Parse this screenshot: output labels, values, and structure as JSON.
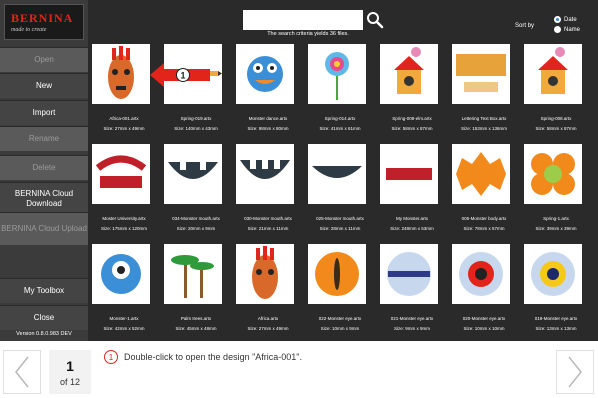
{
  "app": {
    "brand": "BERNINA",
    "tagline": "made to create",
    "version": "Version 0.8.0.983 DEV"
  },
  "sidebar": {
    "buttons": [
      {
        "label": "Open",
        "enabled": false
      },
      {
        "label": "New",
        "enabled": true
      },
      {
        "label": "Import",
        "enabled": true
      },
      {
        "label": "Rename",
        "enabled": false
      },
      {
        "label": "Delete",
        "enabled": false
      },
      {
        "label": "BERNINA Cloud Download",
        "enabled": true
      },
      {
        "label": "BERNINA Cloud Upload",
        "enabled": false
      },
      {
        "label": "My Toolbox",
        "enabled": true
      },
      {
        "label": "Close",
        "enabled": true
      }
    ]
  },
  "search": {
    "value": "",
    "results_text": "The search criteria yields 36 files."
  },
  "sort": {
    "label": "Sort by",
    "options": [
      {
        "label": "Date",
        "selected": true
      },
      {
        "label": "Name",
        "selected": false
      }
    ]
  },
  "files": [
    {
      "name": "Africa-001.artx",
      "size": "Size: 27mm x 49mm",
      "icon": "mask-icon"
    },
    {
      "name": "Spring-019.artx",
      "size": "Size: 140mm x 43mm",
      "icon": "pencil-icon"
    },
    {
      "name": "Monster dance.artx",
      "size": "Size: 98mm x 80mm",
      "icon": "monster-icon"
    },
    {
      "name": "Spring-014.artx",
      "size": "Size: 41mm x 61mm",
      "icon": "flower-icon"
    },
    {
      "name": "Spring-008-elm.artx",
      "size": "Size: 58mm x 87mm",
      "icon": "birdhouse-icon"
    },
    {
      "name": "Lettering Text Box.artx",
      "size": "Size: 153mm x 136mm",
      "icon": "lettering-icon"
    },
    {
      "name": "Spring-008.artx",
      "size": "Size: 58mm x 87mm",
      "icon": "birdhouse-icon"
    },
    {
      "name": "Moster University.artx",
      "size": "Size: 175mm x 120mm",
      "icon": "university-icon"
    },
    {
      "name": "034-Monster mouth.artx",
      "size": "Size: 20mm x 9mm",
      "icon": "mouth-icon"
    },
    {
      "name": "030-Monster mouth.artx",
      "size": "Size: 21mm x 11mm",
      "icon": "mouth-icon"
    },
    {
      "name": "025-Monster mouth.artx",
      "size": "Size: 28mm x 11mm",
      "icon": "mouth-icon"
    },
    {
      "name": "My Monster.artx",
      "size": "Size: 248mm x 53mm",
      "icon": "my-monster-icon"
    },
    {
      "name": "005-Monster body.artx",
      "size": "Size: 78mm x 57mm",
      "icon": "body-icon"
    },
    {
      "name": "Spring-1.artx",
      "size": "Size: 39mm x 39mm",
      "icon": "flower-icon"
    },
    {
      "name": "Monster-1.artx",
      "size": "Size: 42mm x 52mm",
      "icon": "cyclops-icon"
    },
    {
      "name": "Palm trees.artx",
      "size": "Size: 45mm x 48mm",
      "icon": "palm-icon"
    },
    {
      "name": "Africa.artx",
      "size": "Size: 27mm x 49mm",
      "icon": "mask-icon"
    },
    {
      "name": "022-Monster eye.artx",
      "size": "Size: 10mm x 9mm",
      "icon": "eye-icon"
    },
    {
      "name": "021-Monster eye.artx",
      "size": "Size: 9mm x 9mm",
      "icon": "eye-icon"
    },
    {
      "name": "020-Monster eye.artx",
      "size": "Size: 10mm x 10mm",
      "icon": "eye-icon"
    },
    {
      "name": "019-Monster eye.artx",
      "size": "Size: 13mm x 13mm",
      "icon": "eye-icon"
    }
  ],
  "callout": {
    "number": "1",
    "instruction": "Double-click to open the design \"Africa-001\"."
  },
  "pager": {
    "current": "1",
    "of_label": "of 12"
  },
  "colors": {
    "accent": "#e1251b",
    "background": "#2a2a2a",
    "sidebar": "#3b3b3b",
    "radio_selected": "#2f87e0"
  }
}
